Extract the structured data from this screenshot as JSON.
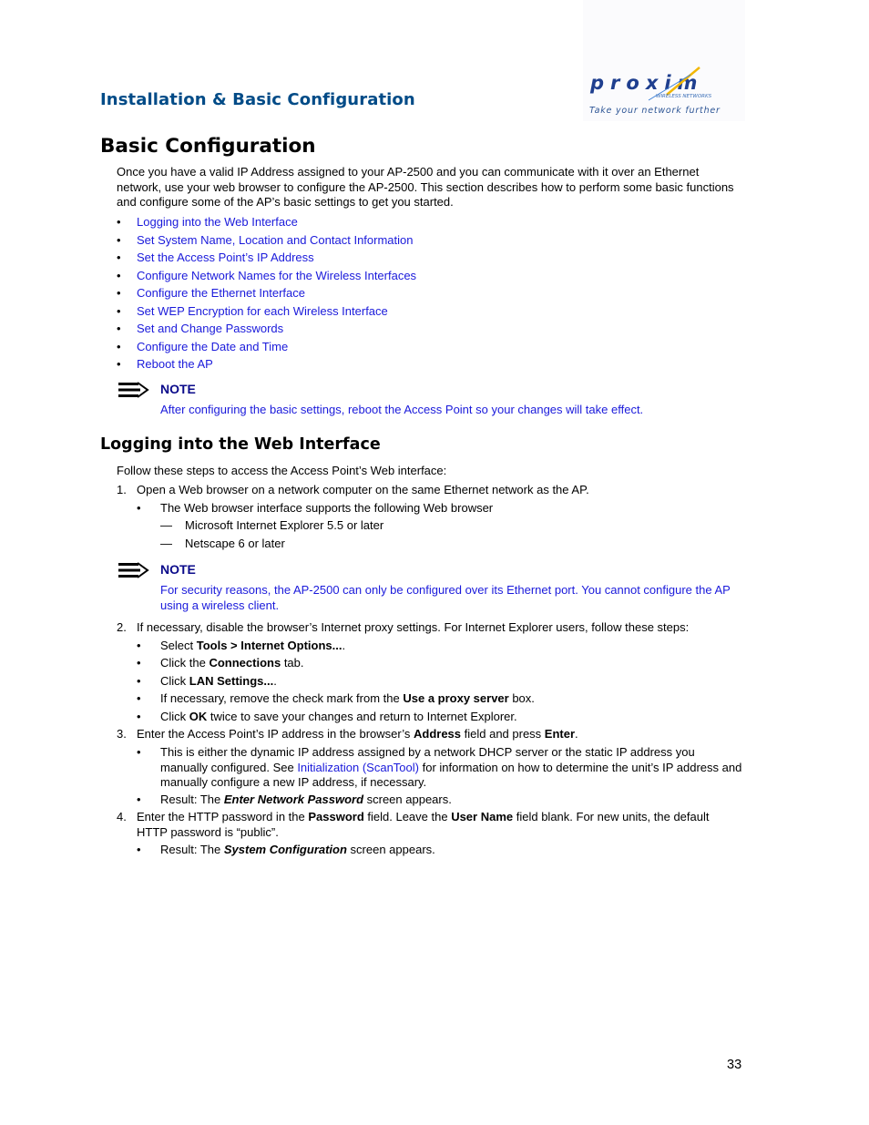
{
  "header": {
    "section_title": "Installation & Basic Configuration",
    "logo": {
      "brand": "proxim",
      "subtitle": "WIRELESS NETWORKS",
      "tagline": "Take your network further",
      "brand_color": "#1f3f8f",
      "accent_color": "#f2b705"
    }
  },
  "main": {
    "title": "Basic Configuration",
    "intro": "Once you have a valid IP Address assigned to your AP-2500 and you can communicate with it over an Ethernet network, use your web browser to configure the AP-2500. This section describes how to perform some basic functions and configure some of the AP’s basic settings to get you started.",
    "toc_bullet": "•",
    "toc": [
      "Logging into the Web Interface",
      "Set System Name, Location and Contact Information",
      "Set the Access Point’s IP Address",
      "Configure Network Names for the Wireless Interfaces",
      "Configure the Ethernet Interface",
      "Set WEP Encryption for each Wireless Interface",
      "Set and Change Passwords",
      "Configure the Date and Time",
      "Reboot the AP"
    ],
    "note1": {
      "icon": "note-arrow-icon",
      "title": "NOTE",
      "text": "After configuring the basic settings, reboot the Access Point so your changes will take effect."
    },
    "section": {
      "title": "Logging into the Web Interface",
      "intro": "Follow these steps to access the Access Point’s Web interface:",
      "step1": {
        "num": "1.",
        "text": "Open a Web browser on a network computer on the same Ethernet network as the AP.",
        "sub": "The Web browser interface supports the following Web browser",
        "dash": "—",
        "browsers": [
          "Microsoft Internet Explorer 5.5 or later",
          "Netscape 6 or later"
        ]
      },
      "note2": {
        "title": "NOTE",
        "text": "For security reasons, the AP-2500 can only be configured over its Ethernet port. You cannot configure the AP using a wireless client."
      },
      "step2": {
        "num": "2.",
        "text": "If necessary, disable the browser’s Internet proxy settings. For Internet Explorer users, follow these steps:",
        "items": [
          {
            "pre": "Select ",
            "bold": "Tools > Internet Options...",
            "post": "."
          },
          {
            "pre": "Click the ",
            "bold": "Connections",
            "post": " tab."
          },
          {
            "pre": "Click ",
            "bold": "LAN Settings...",
            "post": "."
          },
          {
            "pre": "If necessary, remove the check mark from the ",
            "bold": "Use a proxy server",
            "post": " box."
          },
          {
            "pre": "Click ",
            "bold": "OK",
            "post": " twice to save your changes and return to Internet Explorer."
          }
        ]
      },
      "step3": {
        "num": "3.",
        "pre": "Enter the Access Point’s IP address in the browser’s ",
        "bold1": "Address",
        "mid": " field and press ",
        "bold2": "Enter",
        "post": ".",
        "sub1_pre": "This is either the dynamic IP address assigned by a network DHCP server or the static IP address you manually configured. See ",
        "sub1_link": "Initialization (ScanTool)",
        "sub1_post": " for information on how to determine the unit’s IP address and manually configure a new IP address, if necessary.",
        "sub2_pre": "Result: The ",
        "sub2_bold": "Enter Network Password",
        "sub2_post": " screen appears."
      },
      "step4": {
        "num": "4.",
        "pre": "Enter the HTTP password in the ",
        "bold1": "Password",
        "mid": " field. Leave the ",
        "bold2": "User Name",
        "post": " field blank. For new units, the default HTTP password is “public”.",
        "sub_pre": "Result: The ",
        "sub_bold": "System Configuration",
        "sub_post": " screen appears."
      }
    }
  },
  "footer": {
    "page_number": "33"
  }
}
